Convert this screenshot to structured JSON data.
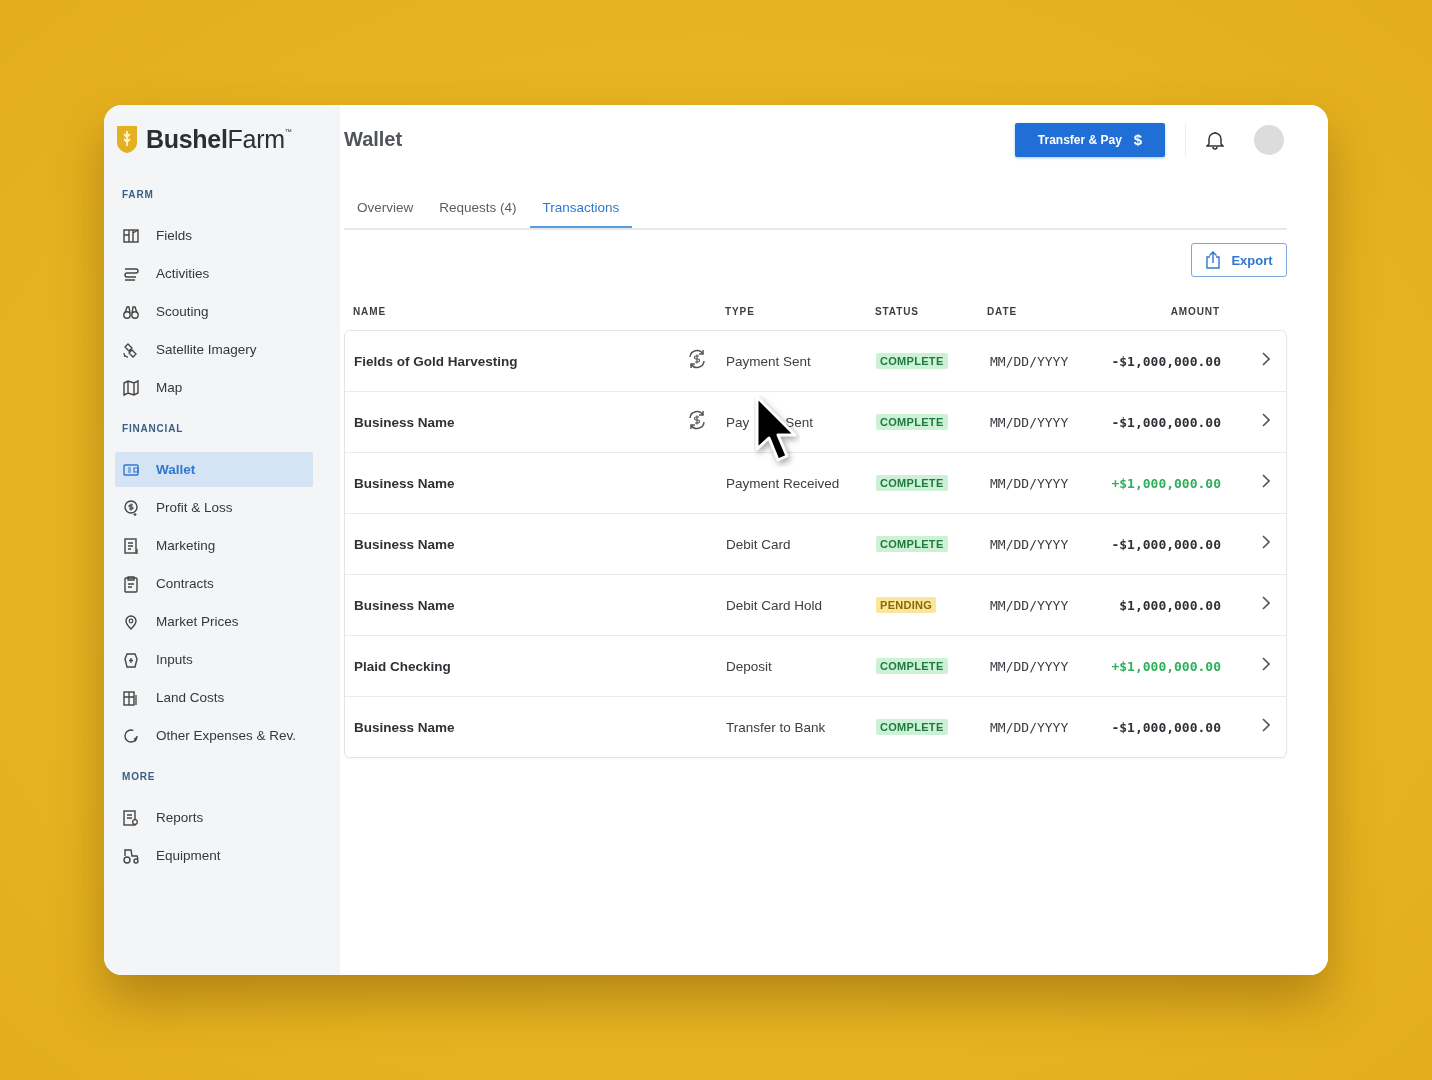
{
  "brand": {
    "bold": "Bushel",
    "light": "Farm",
    "mark": "™"
  },
  "sidebar": {
    "sections": [
      {
        "title": "FARM",
        "items": [
          {
            "label": "Fields",
            "selected": false
          },
          {
            "label": "Activities",
            "selected": false
          },
          {
            "label": "Scouting",
            "selected": false
          },
          {
            "label": "Satellite Imagery",
            "selected": false
          },
          {
            "label": "Map",
            "selected": false
          }
        ]
      },
      {
        "title": "FINANCIAL",
        "items": [
          {
            "label": "Wallet",
            "selected": true
          },
          {
            "label": "Profit & Loss",
            "selected": false
          },
          {
            "label": "Marketing",
            "selected": false
          },
          {
            "label": "Contracts",
            "selected": false
          },
          {
            "label": "Market Prices",
            "selected": false
          },
          {
            "label": "Inputs",
            "selected": false
          },
          {
            "label": "Land Costs",
            "selected": false
          },
          {
            "label": "Other Expenses & Rev.",
            "selected": false
          }
        ]
      },
      {
        "title": "MORE",
        "items": [
          {
            "label": "Reports",
            "selected": false
          },
          {
            "label": "Equipment",
            "selected": false
          }
        ]
      }
    ]
  },
  "header": {
    "title": "Wallet",
    "primary_button": {
      "label": "Transfer & Pay",
      "icon_text": "$"
    }
  },
  "tabs": [
    {
      "label": "Overview",
      "selected": false
    },
    {
      "label": "Requests (4)",
      "selected": false
    },
    {
      "label": "Transactions",
      "selected": true
    }
  ],
  "export_button": {
    "label": "Export"
  },
  "table": {
    "columns": [
      "NAME",
      "TYPE",
      "STATUS",
      "DATE",
      "AMOUNT"
    ],
    "rows": [
      {
        "name": "Fields of Gold Harvesting",
        "recurring": true,
        "type": [
          "Payment Sent"
        ],
        "status": {
          "kind": "complete",
          "label": "COMPLETE"
        },
        "date": "MM/DD/YYYY",
        "amount": "-$1,000,000.00",
        "color": "#2e3236"
      },
      {
        "name": "Business Name",
        "recurring": true,
        "type": [
          "Pay",
          "Sent"
        ],
        "status": {
          "kind": "complete",
          "label": "COMPLETE"
        },
        "date": "MM/DD/YYYY",
        "amount": "-$1,000,000.00",
        "color": "#2e3236"
      },
      {
        "name": "Business Name",
        "recurring": false,
        "type": [
          "Payment Received"
        ],
        "status": {
          "kind": "complete",
          "label": "COMPLETE"
        },
        "date": "MM/DD/YYYY",
        "amount": "+$1,000,000.00",
        "color": "#2fae5c"
      },
      {
        "name": "Business Name",
        "recurring": false,
        "type": [
          "Debit Card"
        ],
        "status": {
          "kind": "complete",
          "label": "COMPLETE"
        },
        "date": "MM/DD/YYYY",
        "amount": "-$1,000,000.00",
        "color": "#2e3236"
      },
      {
        "name": "Business Name",
        "recurring": false,
        "type": [
          "Debit Card Hold"
        ],
        "status": {
          "kind": "pending",
          "label": "PENDING"
        },
        "date": "MM/DD/YYYY",
        "amount": "$1,000,000.00",
        "color": "#2e3236"
      },
      {
        "name": "Plaid Checking",
        "recurring": false,
        "type": [
          "Deposit"
        ],
        "status": {
          "kind": "complete",
          "label": "COMPLETE"
        },
        "date": "MM/DD/YYYY",
        "amount": "+$1,000,000.00",
        "color": "#2fae5c"
      },
      {
        "name": "Business Name",
        "recurring": false,
        "type": [
          "Transfer to Bank"
        ],
        "status": {
          "kind": "complete",
          "label": "COMPLETE"
        },
        "date": "MM/DD/YYYY",
        "amount": "-$1,000,000.00",
        "color": "#2e3236"
      }
    ]
  }
}
